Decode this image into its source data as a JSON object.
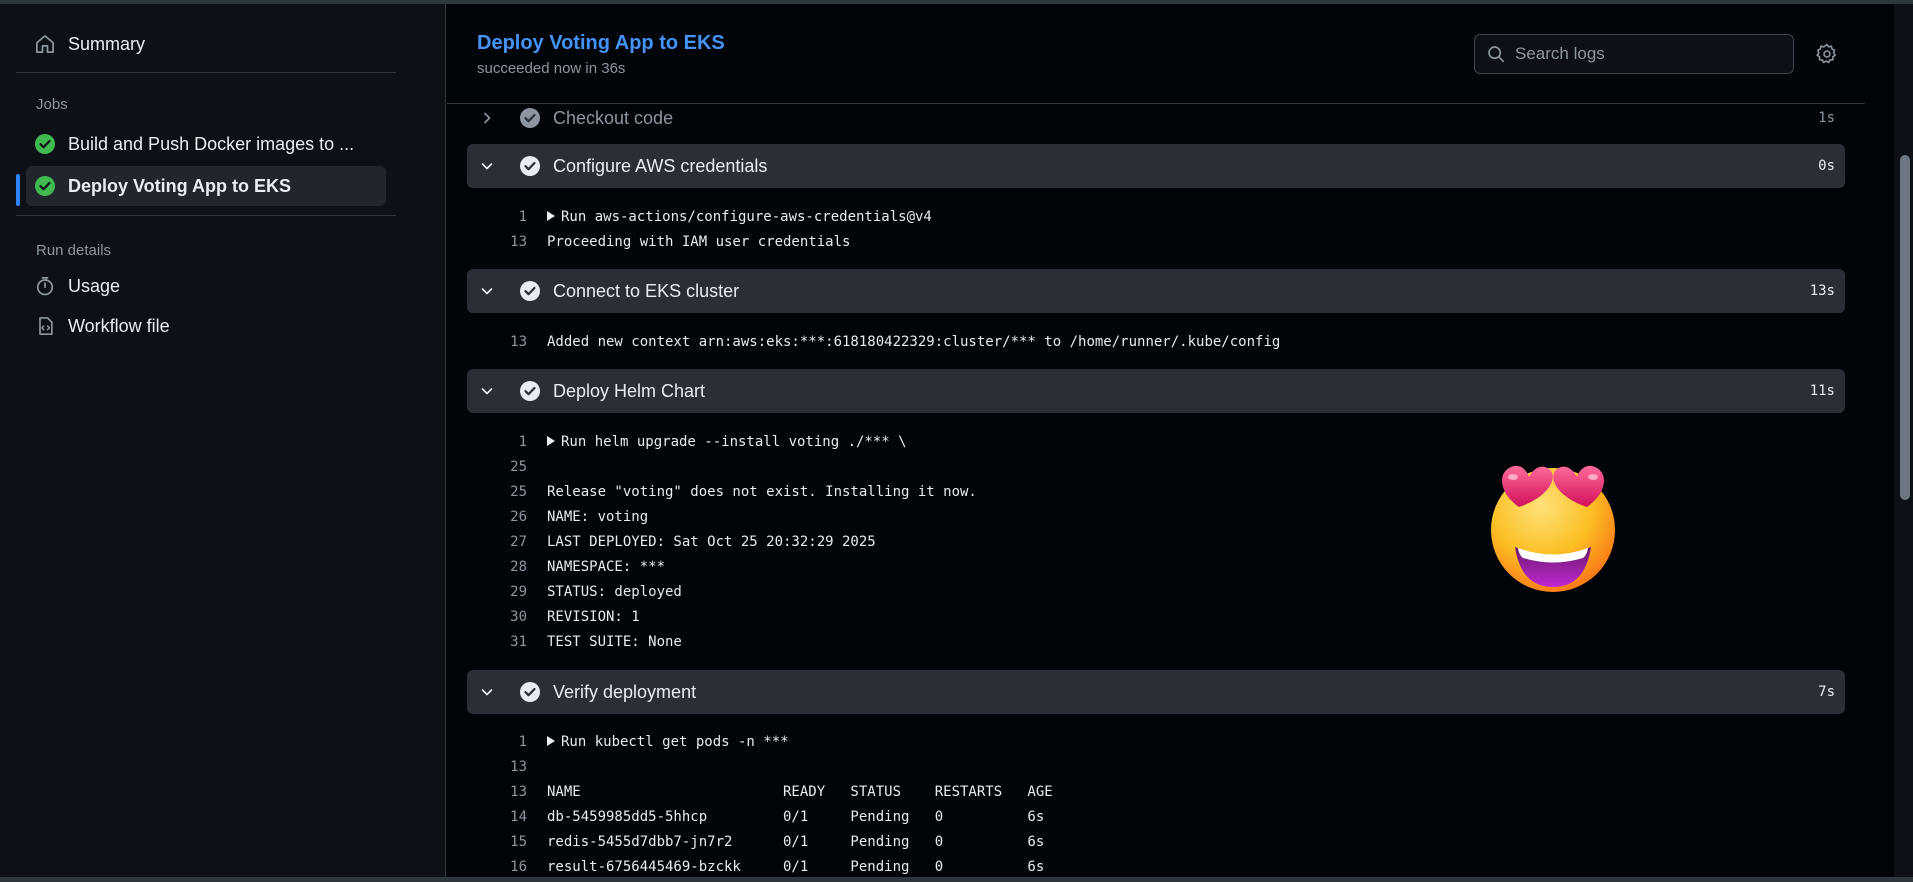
{
  "sidebar": {
    "summary_label": "Summary",
    "jobs_heading": "Jobs",
    "jobs": [
      {
        "label": "Build and Push Docker images to ...",
        "status": "success"
      },
      {
        "label": "Deploy Voting App to EKS",
        "status": "success",
        "active": true
      }
    ],
    "run_details_heading": "Run details",
    "usage_label": "Usage",
    "workflow_file_label": "Workflow file"
  },
  "header": {
    "title": "Deploy Voting App to EKS",
    "status": "succeeded now in 36s",
    "search_placeholder": "Search logs"
  },
  "steps": [
    {
      "name": "Checkout code",
      "duration": "1s",
      "expanded": false
    },
    {
      "name": "Configure AWS credentials",
      "duration": "0s",
      "expanded": true,
      "lines": [
        {
          "n": "1",
          "text": "Run aws-actions/configure-aws-credentials@v4",
          "collapsible": true
        },
        {
          "n": "13",
          "text": "Proceeding with IAM user credentials"
        }
      ]
    },
    {
      "name": "Connect to EKS cluster",
      "duration": "13s",
      "expanded": true,
      "lines": [
        {
          "n": "13",
          "text": "Added new context arn:aws:eks:***:618180422329:cluster/*** to /home/runner/.kube/config"
        }
      ]
    },
    {
      "name": "Deploy Helm Chart",
      "duration": "11s",
      "expanded": true,
      "lines": [
        {
          "n": "1",
          "text": "Run helm upgrade --install voting ./*** \\",
          "collapsible": true
        },
        {
          "n": "25",
          "text": ""
        },
        {
          "n": "25",
          "text": "Release \"voting\" does not exist. Installing it now."
        },
        {
          "n": "26",
          "text": "NAME: voting"
        },
        {
          "n": "27",
          "text": "LAST DEPLOYED: Sat Oct 25 20:32:29 2025"
        },
        {
          "n": "28",
          "text": "NAMESPACE: ***"
        },
        {
          "n": "29",
          "text": "STATUS: deployed"
        },
        {
          "n": "30",
          "text": "REVISION: 1"
        },
        {
          "n": "31",
          "text": "TEST SUITE: None"
        }
      ]
    },
    {
      "name": "Verify deployment",
      "duration": "7s",
      "expanded": true,
      "lines": [
        {
          "n": "1",
          "text": "Run kubectl get pods -n ***",
          "collapsible": true
        },
        {
          "n": "13",
          "text": ""
        },
        {
          "n": "13",
          "text": "NAME                        READY   STATUS    RESTARTS   AGE"
        },
        {
          "n": "14",
          "text": "db-5459985dd5-5hhcp         0/1     Pending   0          6s"
        },
        {
          "n": "15",
          "text": "redis-5455d7dbb7-jn7r2      0/1     Pending   0          6s"
        },
        {
          "n": "16",
          "text": "result-6756445469-bzckk     0/1     Pending   0          6s"
        }
      ]
    }
  ],
  "colors": {
    "success": "#3fb950",
    "accent": "#4493f8"
  },
  "sticker": "heart-eyes-emoji"
}
